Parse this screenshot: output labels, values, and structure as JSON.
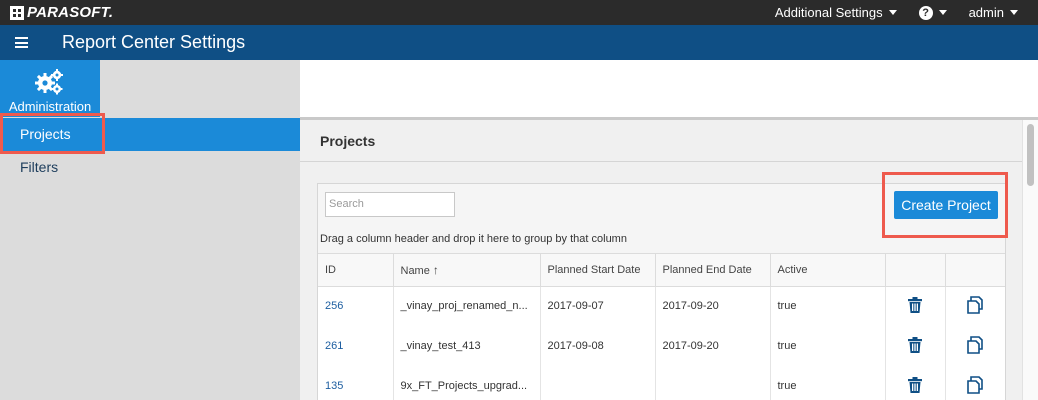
{
  "topbar": {
    "logo_text": "PARASOFT.",
    "additional_settings": "Additional Settings",
    "help_glyph": "?",
    "user": "admin"
  },
  "header": {
    "title": "Report Center Settings"
  },
  "sidebar": {
    "admin_label": "Administration",
    "items": [
      {
        "label": "Projects",
        "active": true
      },
      {
        "label": "Filters",
        "active": false
      }
    ]
  },
  "panel": {
    "title": "Projects",
    "search_placeholder": "Search",
    "create_button": "Create Project",
    "group_hint": "Drag a column header and drop it here to group by that column"
  },
  "table": {
    "columns": [
      "ID",
      "Name",
      "Planned Start Date",
      "Planned End Date",
      "Active",
      "",
      ""
    ],
    "sort_glyph": "↑",
    "rows": [
      {
        "id": "256",
        "name": "_vinay_proj_renamed_n...",
        "start": "2017-09-07",
        "end": "2017-09-20",
        "active": "true"
      },
      {
        "id": "261",
        "name": "_vinay_test_413",
        "start": "2017-09-08",
        "end": "2017-09-20",
        "active": "true"
      },
      {
        "id": "135",
        "name": "9x_FT_Projects_upgrad...",
        "start": "",
        "end": "",
        "active": "true"
      }
    ]
  },
  "icons": {
    "delete": "trash-icon",
    "copy": "copy-icon",
    "admin": "gears-icon",
    "menu": "hamburger-icon"
  },
  "colors": {
    "topbar": "#2b2b2b",
    "header": "#0f4f85",
    "accent": "#1b8ad8",
    "highlight": "#ee5a4d",
    "icon": "#0f4f85"
  }
}
